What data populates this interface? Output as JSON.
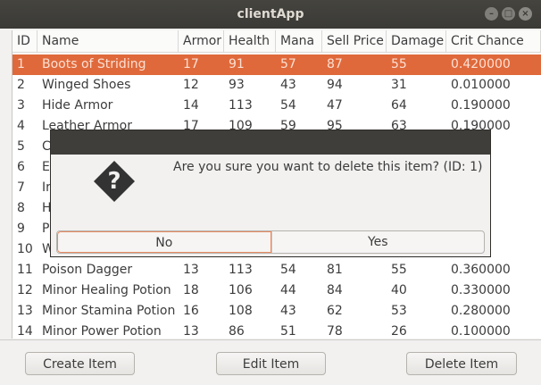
{
  "window": {
    "title": "clientApp"
  },
  "table": {
    "columns": [
      "ID",
      "Name",
      "Armor",
      "Health",
      "Mana",
      "Sell Price",
      "Damage",
      "Crit Chance"
    ],
    "rows": [
      [
        "1",
        "Boots of Striding",
        "17",
        "91",
        "57",
        "87",
        "55",
        "0.420000"
      ],
      [
        "2",
        "Winged Shoes",
        "12",
        "93",
        "43",
        "94",
        "31",
        "0.010000"
      ],
      [
        "3",
        "Hide Armor",
        "14",
        "113",
        "54",
        "47",
        "64",
        "0.190000"
      ],
      [
        "4",
        "Leather Armor",
        "17",
        "109",
        "59",
        "95",
        "63",
        "0.190000"
      ],
      [
        "5",
        "C",
        "",
        "",
        "",
        "",
        "",
        ""
      ],
      [
        "6",
        "E",
        "",
        "",
        "",
        "",
        "",
        ""
      ],
      [
        "7",
        "Ir",
        "",
        "",
        "",
        "",
        "",
        ""
      ],
      [
        "8",
        "H",
        "",
        "",
        "",
        "",
        "",
        ""
      ],
      [
        "9",
        "P",
        "",
        "",
        "",
        "",
        "",
        ""
      ],
      [
        "10",
        "W",
        "",
        "",
        "",
        "",
        "",
        ""
      ],
      [
        "11",
        "Poison Dagger",
        "13",
        "113",
        "54",
        "81",
        "55",
        "0.360000"
      ],
      [
        "12",
        "Minor Healing Potion",
        "18",
        "106",
        "44",
        "84",
        "40",
        "0.330000"
      ],
      [
        "13",
        "Minor Stamina Potion",
        "16",
        "108",
        "43",
        "62",
        "53",
        "0.280000"
      ],
      [
        "14",
        "Minor Power Potion",
        "13",
        "86",
        "51",
        "78",
        "26",
        "0.100000"
      ]
    ]
  },
  "buttons": {
    "create": "Create Item",
    "edit": "Edit Item",
    "delete": "Delete Item"
  },
  "dialog": {
    "message": "Are you sure you want to delete this item? (ID: 1)",
    "no": "No",
    "yes": "Yes",
    "icon": "question-icon"
  },
  "colors": {
    "selection": "#e0693b",
    "titlebar": "#3c3b37",
    "dialog_focus": "#e88c64"
  }
}
